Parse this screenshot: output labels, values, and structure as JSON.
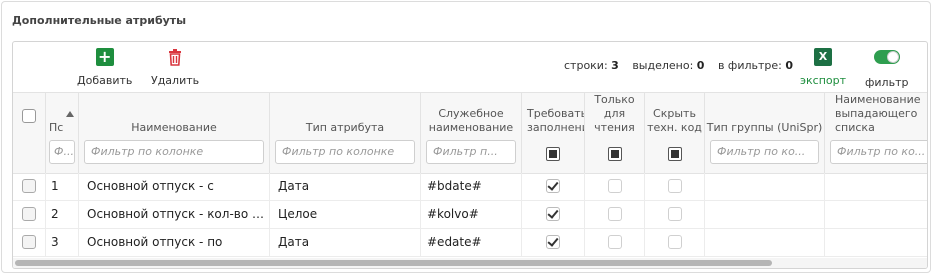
{
  "panel": {
    "title": "Дополнительные атрибуты"
  },
  "toolbar": {
    "add_label": "Добавить",
    "delete_label": "Удалить",
    "rows_label": "строки:",
    "rows_value": "3",
    "selected_label": "выделено:",
    "selected_value": "0",
    "filtered_label": "в фильтре:",
    "filtered_value": "0",
    "export_label": "экспорт",
    "export_icon_text": "X",
    "filter_label": "фильтр",
    "filter_on": true,
    "accent": "#1e8e3e",
    "delete_color": "#d9363e"
  },
  "columns": [
    {
      "key": "select",
      "label": ""
    },
    {
      "key": "order",
      "label": "Пс",
      "filter": "Ф..."
    },
    {
      "key": "name",
      "label": "Наименование",
      "filter": "Фильтр по колонке"
    },
    {
      "key": "type",
      "label": "Тип атрибута",
      "filter": "Фильтр по колонке"
    },
    {
      "key": "service",
      "label": "Служебное наименование",
      "filter": "Фильтр п..."
    },
    {
      "key": "required",
      "label": "Требовать заполнения"
    },
    {
      "key": "readonly",
      "label": "Только для чтения"
    },
    {
      "key": "hidden",
      "label": "Скрыть техн. код"
    },
    {
      "key": "group",
      "label": "Тип группы (UniSpr)",
      "filter": "Фильтр по ко..."
    },
    {
      "key": "dropdown",
      "label": "Наименование выпадающего списка",
      "filter": "Фильтр по ко..."
    }
  ],
  "rows": [
    {
      "order": "1",
      "name": "Основной отпуск - с",
      "type": "Дата",
      "service": "#bdate#",
      "required": true,
      "readonly": false,
      "hidden": false
    },
    {
      "order": "2",
      "name": "Основной отпуск - кол-во дней",
      "type": "Целое",
      "service": "#kolvo#",
      "required": true,
      "readonly": false,
      "hidden": false
    },
    {
      "order": "3",
      "name": "Основной отпуск - по",
      "type": "Дата",
      "service": "#edate#",
      "required": true,
      "readonly": false,
      "hidden": false
    }
  ]
}
